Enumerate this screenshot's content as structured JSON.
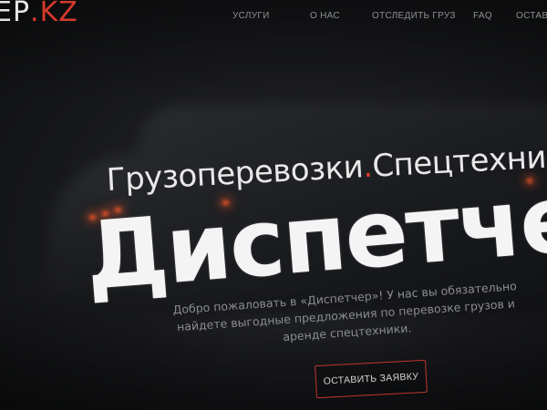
{
  "brand": {
    "logo_prefix": "ЕР",
    "logo_dot": ".",
    "logo_tld": "KZ",
    "accent_color": "#d63a2a"
  },
  "nav": {
    "items": [
      {
        "label": "УСЛУГИ"
      },
      {
        "label": "О НАС"
      },
      {
        "label": "ОТСЛЕДИТЬ ГРУЗ"
      },
      {
        "label": "FAQ"
      },
      {
        "label": "ОСТАВИ"
      }
    ]
  },
  "hero": {
    "title_part1": "Грузоперевозки",
    "title_sep": ".",
    "title_part2": "Спецтехника",
    "title_end": ".",
    "big_title": "Диспетчер",
    "description": "Добро пожаловать в «Диспетчер»! У нас вы обязательно найдете выгодные предложения по перевозке грузов и аренде спецтехники.",
    "cta_label": "ОСТАВИТЬ ЗАЯВКУ"
  }
}
